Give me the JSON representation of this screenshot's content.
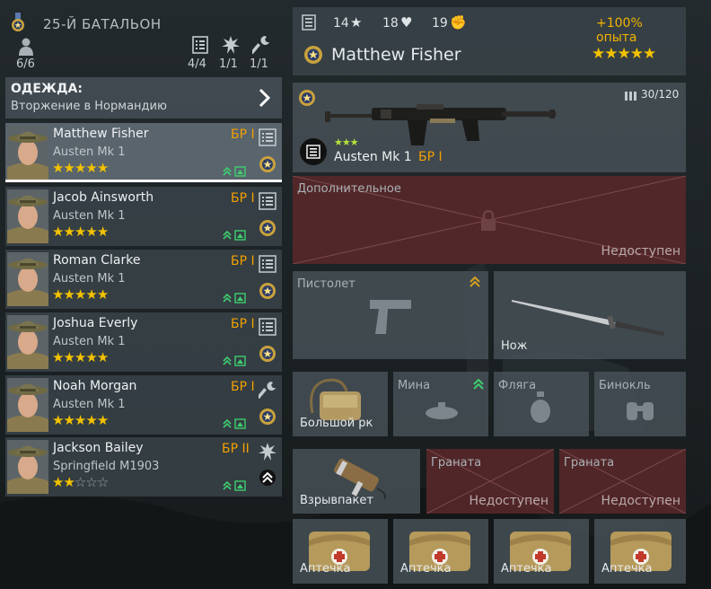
{
  "squad": {
    "title": "25-Й БАТАЛЬОН",
    "members": "6/6",
    "stats": [
      {
        "icon": "document-icon",
        "value": "4/4"
      },
      {
        "icon": "explosion-icon",
        "value": "1/1"
      },
      {
        "icon": "wrench-icon",
        "value": "1/1"
      }
    ]
  },
  "outfit": {
    "title": "ОДЕЖДА:",
    "subtitle": "Вторжение в Нормандию"
  },
  "soldiers": [
    {
      "name": "Matthew Fisher",
      "weapon": "Austen Mk 1",
      "rank": "БР I",
      "stars": 5,
      "role": "document-icon",
      "selected": true
    },
    {
      "name": "Jacob Ainsworth",
      "weapon": "Austen Mk 1",
      "rank": "БР I",
      "stars": 5,
      "role": "document-icon"
    },
    {
      "name": "Roman Clarke",
      "weapon": "Austen Mk 1",
      "rank": "БР I",
      "stars": 5,
      "role": "document-icon"
    },
    {
      "name": "Joshua Everly",
      "weapon": "Austen Mk 1",
      "rank": "БР I",
      "stars": 5,
      "role": "document-icon"
    },
    {
      "name": "Noah Morgan",
      "weapon": "Austen Mk 1",
      "rank": "БР I",
      "stars": 5,
      "role": "wrench-icon"
    },
    {
      "name": "Jackson Bailey",
      "weapon": "Springfield M1903",
      "rank": "БР II",
      "stars": 2,
      "role": "explosion-icon"
    }
  ],
  "header": {
    "stats": [
      "14",
      "18",
      "19"
    ],
    "xp_bonus": "+100% опыта",
    "name": "Matthew Fisher",
    "stars": 5
  },
  "primary": {
    "weapon": "Austen Mk 1",
    "rank": "БР I",
    "ammo": "30/120",
    "stars": 3
  },
  "slots": {
    "additional": {
      "label": "Дополнительное",
      "status": "Недоступен"
    },
    "pistol": {
      "label": "Пистолет"
    },
    "knife": {
      "label": "Нож"
    },
    "backpack": {
      "label": "Большой рк"
    },
    "mine": {
      "label": "Мина"
    },
    "flask": {
      "label": "Фляга"
    },
    "binoculars": {
      "label": "Бинокль"
    },
    "explosive": {
      "label": "Взрывпакет"
    },
    "grenade1": {
      "label": "Граната",
      "status": "Недоступен"
    },
    "grenade2": {
      "label": "Граната",
      "status": "Недоступен"
    },
    "medkits": [
      "Аптечка",
      "Аптечка",
      "Аптечка",
      "Аптечка"
    ]
  },
  "colors": {
    "accent": "#f2b400",
    "rank": "#f2a000",
    "locked": "#5c282a",
    "upgrade": "#2ecc71"
  }
}
